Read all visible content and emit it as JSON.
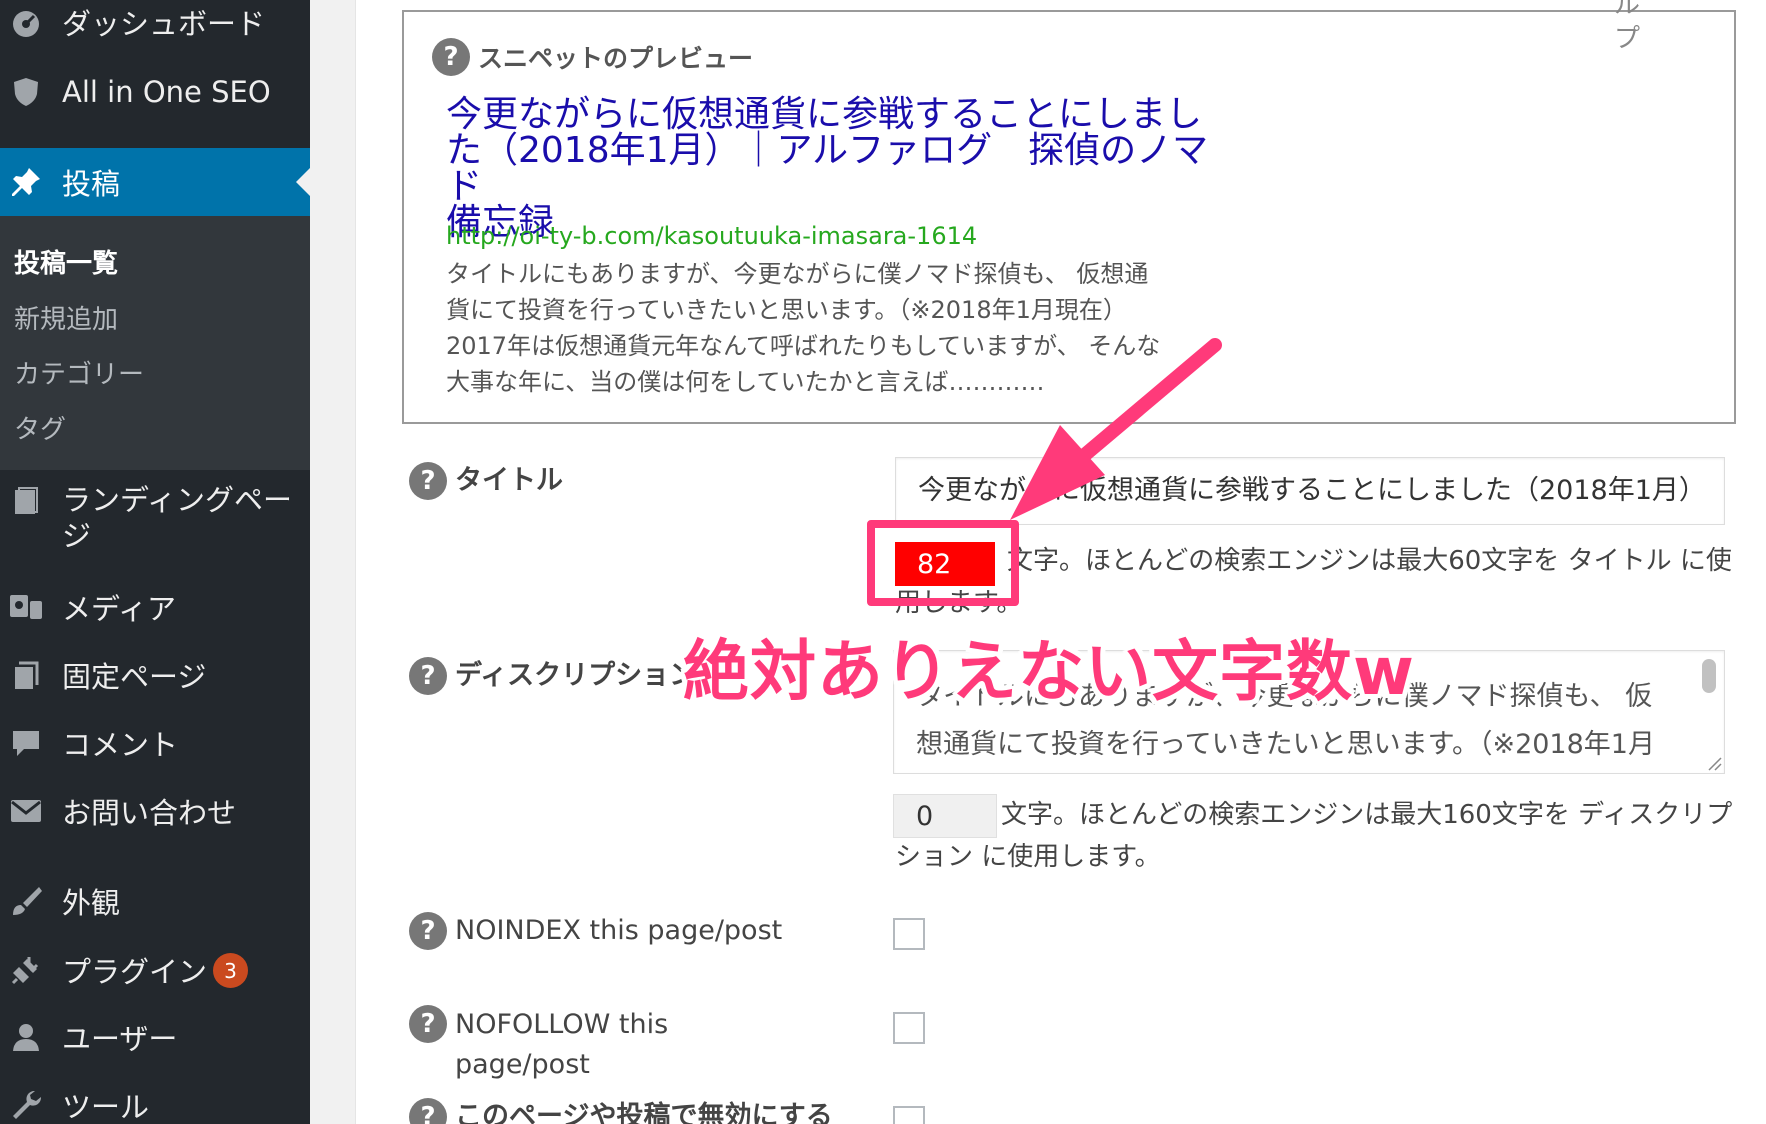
{
  "sidebar": {
    "items": [
      {
        "label": "ダッシュボード",
        "icon": "dashboard-icon"
      },
      {
        "label": "All in One SEO",
        "icon": "shield-icon"
      },
      {
        "label": "投稿",
        "icon": "pin-icon"
      },
      {
        "label": "ランディングページ",
        "icon": "book-icon"
      },
      {
        "label": "メディア",
        "icon": "media-icon"
      },
      {
        "label": "固定ページ",
        "icon": "page-icon"
      },
      {
        "label": "コメント",
        "icon": "comment-icon"
      },
      {
        "label": "お問い合わせ",
        "icon": "mail-icon"
      },
      {
        "label": "外観",
        "icon": "brush-icon"
      },
      {
        "label": "プラグイン",
        "icon": "plugin-icon",
        "badge": "3"
      },
      {
        "label": "ユーザー",
        "icon": "user-icon"
      },
      {
        "label": "ツール",
        "icon": "wrench-icon"
      }
    ],
    "submenu": [
      "投稿一覧",
      "新規追加",
      "カテゴリー",
      "タグ"
    ]
  },
  "snippet": {
    "heading": "スニペットのプレビュー",
    "title_lines": [
      "今更ながらに仮想通貨に参戦することにしまし",
      "た（2018年1月）｜アルファログ　探偵のノマド",
      "備忘録"
    ],
    "url": "http://oi-ty-b.com/kasoutuuka-imasara-1614",
    "desc_lines": [
      "タイトルにもありますが、今更ながらに僕ノマド探偵も、 仮想通",
      "貨にて投資を行っていきたいと思います。（※2018年1月現在）",
      "2017年は仮想通貨元年なんて呼ばれたりもしていますが、 そんな",
      "大事な年に、当の僕は何をしていたかと言えば…………"
    ],
    "side_text": [
      "ル",
      "プ"
    ]
  },
  "title_field": {
    "label": "タイトル",
    "value": "今更ながらに仮想通貨に参戦することにしました（2018年1月）",
    "count": "82",
    "help_lines": [
      "文字。ほとんどの検索エンジンは最大60文字を タイトル に使",
      "用します。"
    ]
  },
  "description_field": {
    "label": "ディスクリプション",
    "value_lines": [
      "タイトルにもありますが、今更ながらに僕ノマド探偵も、 仮",
      "想通貨にて投資を行っていきたいと思います。（※2018年1月"
    ],
    "count": "0",
    "help_lines": [
      "文字。ほとんどの検索エンジンは最大160文字を ディスクリプ",
      "ション に使用します。"
    ]
  },
  "noindex": {
    "label": "NOINDEX this page/post"
  },
  "nofollow": {
    "label_lines": [
      "NOFOLLOW this",
      "page/post"
    ]
  },
  "disable": {
    "label": "このページや投稿で無効にする"
  },
  "annotation": {
    "text": "絶対ありえない文字数w"
  },
  "colors": {
    "sidebar": "#23282d",
    "submenu": "#32373c",
    "accent": "#0073aa",
    "link": "#1a0dab",
    "url": "#26a81e",
    "counter_red": "#ff0000",
    "annotation_pink": "#ff3a7a"
  }
}
